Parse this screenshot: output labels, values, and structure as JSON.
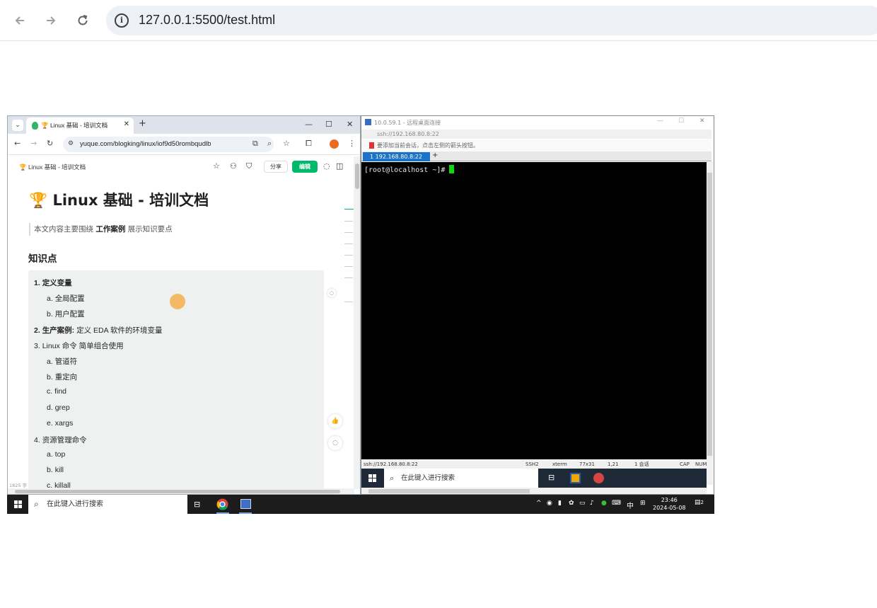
{
  "browser": {
    "back_icon": "arrow-left-icon",
    "forward_icon": "arrow-right-icon",
    "reload_icon": "reload-icon",
    "url": "127.0.0.1:5500/test.html"
  },
  "chrome": {
    "tab_title": "🏆 Linux 基础 - 培训文档",
    "url": "yuque.com/blogking/linux/iof9d50rombqudlb"
  },
  "doc": {
    "breadcrumb": "🏆 Linux 基础 - 培训文档",
    "share_label": "分享",
    "edit_label": "编辑",
    "title": "🏆 Linux 基础 - 培训文档",
    "quote_pre": "本文内容主要围绕",
    "quote_bold": "工作案例",
    "quote_post": "展示知识要点",
    "section_heading": "知识点",
    "outline": [
      {
        "num": "1.",
        "text": "定义变量",
        "bold": true
      },
      {
        "num": "a.",
        "text": "全局配置",
        "bold": false
      },
      {
        "num": "b.",
        "text": "用户配置",
        "bold": false
      },
      {
        "num": "2.",
        "text": "生产案例:",
        "rest": "定义 EDA 软件的环境变量",
        "bold": true
      },
      {
        "num": "3.",
        "text": "Linux 命令 简单组合使用",
        "bold": false
      },
      {
        "num": "a.",
        "text": "管道符",
        "bold": false
      },
      {
        "num": "b.",
        "text": "重定向",
        "bold": false
      },
      {
        "num": "c.",
        "text": "find",
        "bold": false
      },
      {
        "num": "d.",
        "text": "grep",
        "bold": false
      },
      {
        "num": "e.",
        "text": "xargs",
        "bold": false
      },
      {
        "num": "4.",
        "text": "资源管理命令",
        "bold": false
      },
      {
        "num": "a.",
        "text": "top",
        "bold": false
      },
      {
        "num": "b.",
        "text": "kill",
        "bold": false
      },
      {
        "num": "c.",
        "text": "killall",
        "bold": false
      }
    ],
    "word_count": "1825 字"
  },
  "rdp": {
    "window_title": "10.0.59.1 - 远程桌面连接",
    "ssh_address": "ssh://192.168.80.8:22",
    "hint": "要添加当前会话，点击左侧的箭头按钮。",
    "session_tab": "1 192.168.80.8:22",
    "prompt": "[root@localhost ~]# ",
    "status": {
      "address": "ssh://192.168.80.8:22",
      "protocol": "SSH2",
      "term": "xterm",
      "size": "77x31",
      "pos": "1,21",
      "sessions": "1 会话",
      "cap": "CAP",
      "num": "NUM"
    },
    "taskbar_search": "在此键入进行搜索"
  },
  "taskbar": {
    "search": "在此键入进行搜索",
    "ime": "中",
    "time": "23:46",
    "date": "2024-05-08",
    "notifications": "2"
  }
}
